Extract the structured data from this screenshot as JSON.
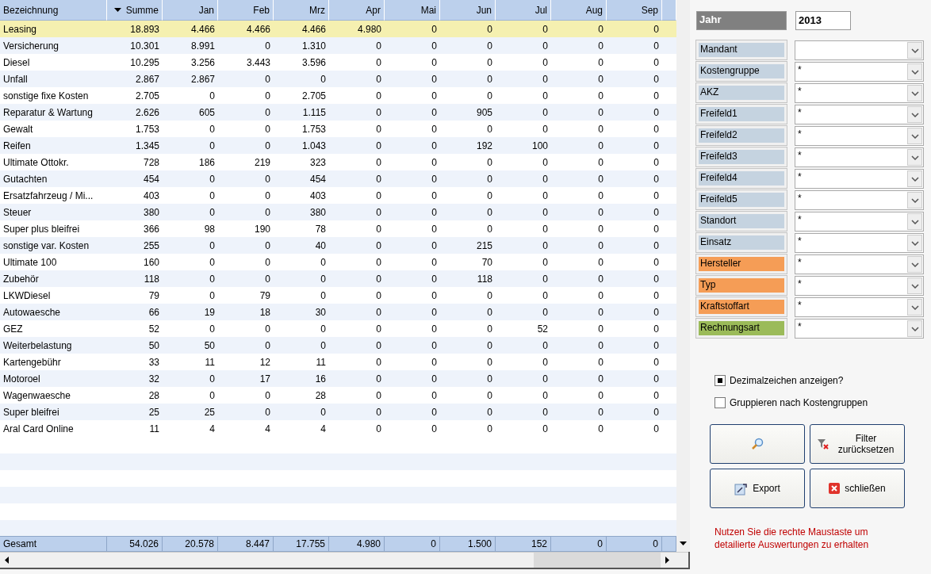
{
  "table": {
    "columns": [
      {
        "label": "Bezeichnung",
        "sorted": false
      },
      {
        "label": "Summe",
        "sorted": true
      },
      {
        "label": "Jan",
        "sorted": false
      },
      {
        "label": "Feb",
        "sorted": false
      },
      {
        "label": "Mrz",
        "sorted": false
      },
      {
        "label": "Apr",
        "sorted": false
      },
      {
        "label": "Mai",
        "sorted": false
      },
      {
        "label": "Jun",
        "sorted": false
      },
      {
        "label": "Jul",
        "sorted": false
      },
      {
        "label": "Aug",
        "sorted": false
      },
      {
        "label": "Sep",
        "sorted": false
      }
    ],
    "rows": [
      {
        "label": "Leasing",
        "selected": true,
        "values": [
          "18.893",
          "4.466",
          "4.466",
          "4.466",
          "4.980",
          "0",
          "0",
          "0",
          "0",
          "0"
        ]
      },
      {
        "label": "Versicherung",
        "selected": false,
        "values": [
          "10.301",
          "8.991",
          "0",
          "1.310",
          "0",
          "0",
          "0",
          "0",
          "0",
          "0"
        ]
      },
      {
        "label": "Diesel",
        "selected": false,
        "values": [
          "10.295",
          "3.256",
          "3.443",
          "3.596",
          "0",
          "0",
          "0",
          "0",
          "0",
          "0"
        ]
      },
      {
        "label": "Unfall",
        "selected": false,
        "values": [
          "2.867",
          "2.867",
          "0",
          "0",
          "0",
          "0",
          "0",
          "0",
          "0",
          "0"
        ]
      },
      {
        "label": "sonstige fixe Kosten",
        "selected": false,
        "values": [
          "2.705",
          "0",
          "0",
          "2.705",
          "0",
          "0",
          "0",
          "0",
          "0",
          "0"
        ]
      },
      {
        "label": "Reparatur & Wartung",
        "selected": false,
        "values": [
          "2.626",
          "605",
          "0",
          "1.115",
          "0",
          "0",
          "905",
          "0",
          "0",
          "0"
        ]
      },
      {
        "label": "Gewalt",
        "selected": false,
        "values": [
          "1.753",
          "0",
          "0",
          "1.753",
          "0",
          "0",
          "0",
          "0",
          "0",
          "0"
        ]
      },
      {
        "label": "Reifen",
        "selected": false,
        "values": [
          "1.345",
          "0",
          "0",
          "1.043",
          "0",
          "0",
          "192",
          "100",
          "0",
          "0"
        ]
      },
      {
        "label": "Ultimate Ottokr.",
        "selected": false,
        "values": [
          "728",
          "186",
          "219",
          "323",
          "0",
          "0",
          "0",
          "0",
          "0",
          "0"
        ]
      },
      {
        "label": "Gutachten",
        "selected": false,
        "values": [
          "454",
          "0",
          "0",
          "454",
          "0",
          "0",
          "0",
          "0",
          "0",
          "0"
        ]
      },
      {
        "label": "Ersatzfahrzeug / Mi...",
        "selected": false,
        "values": [
          "403",
          "0",
          "0",
          "403",
          "0",
          "0",
          "0",
          "0",
          "0",
          "0"
        ]
      },
      {
        "label": "Steuer",
        "selected": false,
        "values": [
          "380",
          "0",
          "0",
          "380",
          "0",
          "0",
          "0",
          "0",
          "0",
          "0"
        ]
      },
      {
        "label": "Super plus bleifrei",
        "selected": false,
        "values": [
          "366",
          "98",
          "190",
          "78",
          "0",
          "0",
          "0",
          "0",
          "0",
          "0"
        ]
      },
      {
        "label": "sonstige var. Kosten",
        "selected": false,
        "values": [
          "255",
          "0",
          "0",
          "40",
          "0",
          "0",
          "215",
          "0",
          "0",
          "0"
        ]
      },
      {
        "label": "Ultimate 100",
        "selected": false,
        "values": [
          "160",
          "0",
          "0",
          "0",
          "0",
          "0",
          "70",
          "0",
          "0",
          "0"
        ]
      },
      {
        "label": "Zubehör",
        "selected": false,
        "values": [
          "118",
          "0",
          "0",
          "0",
          "0",
          "0",
          "118",
          "0",
          "0",
          "0"
        ]
      },
      {
        "label": "LKWDiesel",
        "selected": false,
        "values": [
          "79",
          "0",
          "79",
          "0",
          "0",
          "0",
          "0",
          "0",
          "0",
          "0"
        ]
      },
      {
        "label": "Autowaesche",
        "selected": false,
        "values": [
          "66",
          "19",
          "18",
          "30",
          "0",
          "0",
          "0",
          "0",
          "0",
          "0"
        ]
      },
      {
        "label": "GEZ",
        "selected": false,
        "values": [
          "52",
          "0",
          "0",
          "0",
          "0",
          "0",
          "0",
          "52",
          "0",
          "0"
        ]
      },
      {
        "label": "Weiterbelastung",
        "selected": false,
        "values": [
          "50",
          "50",
          "0",
          "0",
          "0",
          "0",
          "0",
          "0",
          "0",
          "0"
        ]
      },
      {
        "label": "Kartengebühr",
        "selected": false,
        "values": [
          "33",
          "11",
          "12",
          "11",
          "0",
          "0",
          "0",
          "0",
          "0",
          "0"
        ]
      },
      {
        "label": "Motoroel",
        "selected": false,
        "values": [
          "32",
          "0",
          "17",
          "16",
          "0",
          "0",
          "0",
          "0",
          "0",
          "0"
        ]
      },
      {
        "label": "Wagenwaesche",
        "selected": false,
        "values": [
          "28",
          "0",
          "0",
          "28",
          "0",
          "0",
          "0",
          "0",
          "0",
          "0"
        ]
      },
      {
        "label": "Super bleifrei",
        "selected": false,
        "values": [
          "25",
          "25",
          "0",
          "0",
          "0",
          "0",
          "0",
          "0",
          "0",
          "0"
        ]
      },
      {
        "label": "Aral Card Online",
        "selected": false,
        "values": [
          "11",
          "4",
          "4",
          "4",
          "0",
          "0",
          "0",
          "0",
          "0",
          "0"
        ]
      }
    ],
    "total": {
      "label": "Gesamt",
      "values": [
        "54.026",
        "20.578",
        "8.447",
        "17.755",
        "4.980",
        "0",
        "1.500",
        "152",
        "0",
        "0"
      ]
    }
  },
  "year": {
    "label": "Jahr",
    "value": "2013"
  },
  "filters": [
    {
      "label": "Mandant",
      "color": "#c5d3e0"
    },
    {
      "label": "Kostengruppe",
      "color": "#c5d3e0",
      "value": "*"
    },
    {
      "label": "AKZ",
      "color": "#c5d3e0",
      "value": "*"
    },
    {
      "label": "Freifeld1",
      "color": "#c5d3e0",
      "value": "*"
    },
    {
      "label": "Freifeld2",
      "color": "#c5d3e0",
      "value": "*"
    },
    {
      "label": "Freifeld3",
      "color": "#c5d3e0",
      "value": "*"
    },
    {
      "label": "Freifeld4",
      "color": "#c5d3e0",
      "value": "*"
    },
    {
      "label": "Freifeld5",
      "color": "#c5d3e0",
      "value": "*"
    },
    {
      "label": "Standort",
      "color": "#c5d3e0",
      "value": "*"
    },
    {
      "label": "Einsatz",
      "color": "#c5d3e0",
      "value": "*"
    },
    {
      "label": "Hersteller",
      "color": "#f59d56",
      "value": "*"
    },
    {
      "label": "Typ",
      "color": "#f59d56",
      "value": "*"
    },
    {
      "label": "Kraftstoffart",
      "color": "#f59d56",
      "value": "*"
    },
    {
      "label": "Rechnungsart",
      "color": "#9bbb59",
      "value": "*"
    }
  ],
  "options": [
    {
      "label": "Dezimalzeichen anzeigen?",
      "checked": true
    },
    {
      "label": "Gruppieren nach Kostengruppen",
      "checked": false
    }
  ],
  "buttons": [
    {
      "kind": "search"
    },
    {
      "kind": "filter-reset",
      "label": "Filter zurücksetzen"
    },
    {
      "kind": "export",
      "label": "Export"
    },
    {
      "kind": "close",
      "label": "schließen"
    }
  ],
  "hint": "Nutzen Sie die rechte Maustaste um detailierte Auswertungen zu erhalten"
}
